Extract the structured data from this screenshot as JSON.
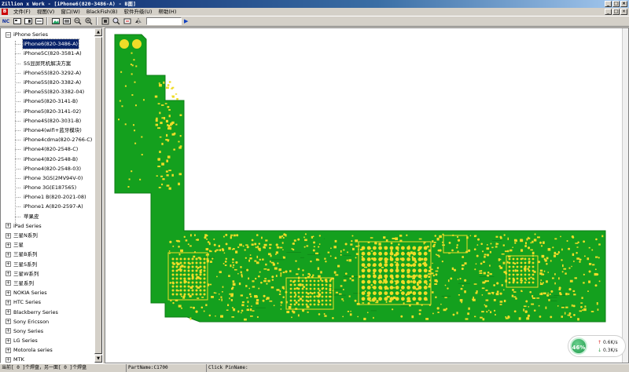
{
  "window": {
    "title": "Zillion x Work - [iPhone6(820-3486-A) - B面]",
    "controls": [
      "_",
      "□",
      "×"
    ]
  },
  "menu": {
    "app_icon": "B",
    "items": [
      "文件(F)",
      "视图(V)",
      "窗口(W)",
      "BlackFish(B)",
      "软件升级(U)",
      "帮助(H)"
    ],
    "mdi_controls": [
      "_",
      "□",
      "×"
    ]
  },
  "toolbar": {
    "nc_label": "NC",
    "search_value": "",
    "icons": [
      "board-view-icon",
      "board-front-icon",
      "board-back-icon",
      "image-icon",
      "part-icon",
      "zoom-out-icon",
      "zoom-in-icon",
      "fit-icon",
      "zoom-area-icon",
      "rotate-icon",
      "mirror-icon",
      "go-icon"
    ]
  },
  "tree": {
    "root": {
      "label": "iPhone Series",
      "expanded": true,
      "toggle": "−"
    },
    "children": [
      "iPhone6(820-3486-A)",
      "iPhone5C(820-3581-A)",
      "5S显屏死机解决方案",
      "iPhone5S(820-3292-A)",
      "iPhone5S(820-3382-A)",
      "iPhone5S(820-3382-04)",
      "iPhone5(820-3141-B)",
      "iPhone5(820-3141-02)",
      "iPhone4S(820-3031-B)",
      "iPhone4(wifi+蓝牙模块)",
      "iPhone4cdma(820-2766-C)",
      "iPhone4(820-2548-C)",
      "iPhone4(820-2548-B)",
      "iPhone4(820-2548-03)",
      "iPhone 3GS(2MV94V-0)",
      "iPhone 3G(E187565)",
      "iPhone1 B(820-2021-08)",
      "iPhone1 A(820-2597-A)",
      "苹果皮"
    ],
    "selected_index": 0,
    "groups": [
      "iPad Series",
      "三星N系列",
      "三星",
      "三星B系列",
      "三星S系列",
      "三星W系列",
      "三星系列",
      "NOKIA Series",
      "HTC Series",
      "Blackberry Series",
      "Sony Ericsson",
      "Sony Series",
      "LG Series",
      "Motorola series",
      "MTK"
    ],
    "collapsed_toggle": "+"
  },
  "status": {
    "left": "当前[ 0 ]个焊盘，另一面[ 0 ]个焊盘",
    "part_name": "PartName:C1700",
    "click_pin": "Click PinName:"
  },
  "speed_widget": {
    "percent": "46%",
    "upload": "0.6K/s",
    "download": "0.3K/s",
    "up_arrow": "↑",
    "down_arrow": "↓"
  },
  "colors": {
    "board_green": "#14a01e",
    "pad_yellow": "#f0dc28",
    "selection": "#0a246a",
    "title_blue": "#0a246a"
  }
}
